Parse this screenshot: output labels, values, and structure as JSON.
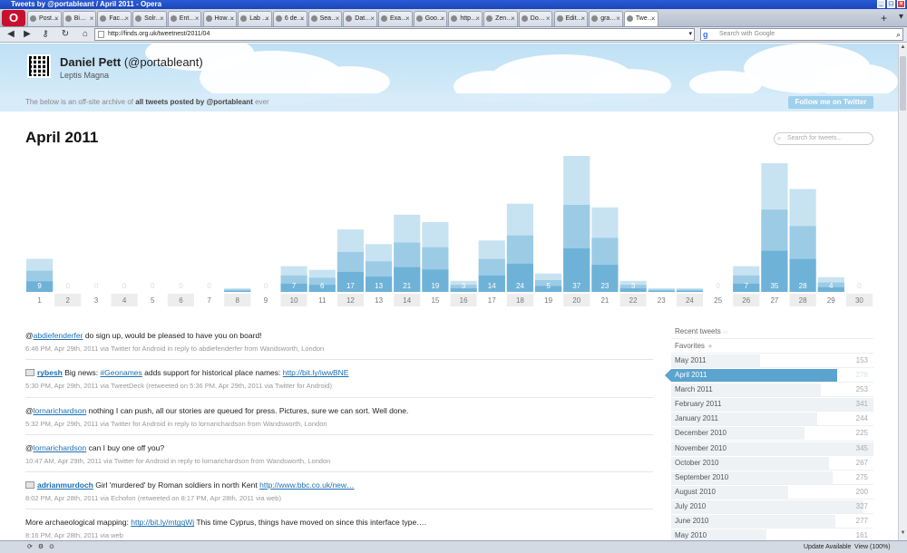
{
  "window": {
    "title": "Tweets by @portableant / April 2011 - Opera"
  },
  "tabs": [
    {
      "label": "Post…"
    },
    {
      "label": "Bi…"
    },
    {
      "label": "Fac…"
    },
    {
      "label": "Solr…"
    },
    {
      "label": "Ent…"
    },
    {
      "label": "How…"
    },
    {
      "label": "Lab …"
    },
    {
      "label": "6 de…"
    },
    {
      "label": "Sea…"
    },
    {
      "label": "Dat…"
    },
    {
      "label": "Exa…"
    },
    {
      "label": "Goo…"
    },
    {
      "label": "http…"
    },
    {
      "label": "Zen…"
    },
    {
      "label": "Do…"
    },
    {
      "label": "Edit…"
    },
    {
      "label": "gra…"
    },
    {
      "label": "Twe…"
    }
  ],
  "address": {
    "url": "http://finds.org.uk/tweetnest/2011/04",
    "search_placeholder": "Search with Google"
  },
  "profile": {
    "name": "Daniel Pett",
    "handle": "(@portableant)",
    "location": "Leptis Magna",
    "archive_pre": "The below is an off-site archive of ",
    "archive_bold": "all tweets posted by @portableant",
    "archive_post": " ever",
    "follow_label": "Follow me on Twitter"
  },
  "page": {
    "month_title": "April 2011",
    "search_placeholder": "Search for tweets..."
  },
  "chart_data": {
    "type": "bar",
    "categories": [
      "1",
      "2",
      "3",
      "4",
      "5",
      "6",
      "7",
      "8",
      "9",
      "10",
      "11",
      "12",
      "13",
      "14",
      "15",
      "16",
      "17",
      "18",
      "19",
      "20",
      "21",
      "22",
      "23",
      "24",
      "25",
      "26",
      "27",
      "28",
      "29",
      "30"
    ],
    "values": [
      9,
      0,
      0,
      0,
      0,
      0,
      0,
      1,
      0,
      7,
      6,
      17,
      13,
      21,
      19,
      3,
      14,
      24,
      5,
      37,
      23,
      3,
      1,
      1,
      0,
      7,
      35,
      28,
      4,
      0
    ],
    "bar_labels": [
      "9",
      "0",
      "0",
      "0",
      "0",
      "0",
      "0",
      "",
      "0",
      "7",
      "6",
      "17",
      "13",
      "21",
      "19",
      "3",
      "14",
      "24",
      "5",
      "37",
      "23",
      "3",
      "",
      "",
      "0",
      "7",
      "35",
      "28",
      "4",
      "0"
    ],
    "colors": {
      "light": "#c7e3f2",
      "mid": "#9ccbe5",
      "dark": "#6fb2d8",
      "label": "#ffffff",
      "zero": "#dddddd"
    },
    "title": "",
    "xlabel": "",
    "ylabel": ""
  },
  "tweets": [
    {
      "rt": false,
      "user": "",
      "pre": "@",
      "link": "abdiefenderfer",
      "text": " do sign up, would be pleased to have you on board!",
      "link2": "",
      "text2": "",
      "meta": "6:46 PM, Apr 29th, 2011 via Twitter for Android in reply to abdiefenderfer from Wandsworth, London"
    },
    {
      "rt": true,
      "user": "rybesh",
      "pre": " Big news: ",
      "link": "#Geonames",
      "text": " adds support for historical place names: ",
      "link2": "http://bit.ly/iwwBNE",
      "text2": "",
      "meta": "5:30 PM, Apr 29th, 2011 via TweetDeck (retweeted on 5:36 PM, Apr 29th, 2011 via Twitter for Android)"
    },
    {
      "rt": false,
      "user": "",
      "pre": "@",
      "link": "lornarichardson",
      "text": " nothing I can push, all our stories are queued for press. Pictures, sure we can sort. Well done.",
      "link2": "",
      "text2": "",
      "meta": "5:32 PM, Apr 29th, 2011 via Twitter for Android in reply to lornarichardson from Wandsworth, London"
    },
    {
      "rt": false,
      "user": "",
      "pre": "@",
      "link": "lornarichardson",
      "text": " can I buy one off you?",
      "link2": "",
      "text2": "",
      "meta": "10:47 AM, Apr 29th, 2011 via Twitter for Android in reply to lornarichardson from Wandsworth, London"
    },
    {
      "rt": true,
      "user": "adrianmurdoch",
      "pre": " Girl 'murdered' by Roman soldiers in north Kent ",
      "link": "http://www.bbc.co.uk/new…",
      "text": "",
      "link2": "",
      "text2": "",
      "meta": "8:02 PM, Apr 28th, 2011 via Echofon (retweeted on 8:17 PM, Apr 28th, 2011 via web)"
    },
    {
      "rt": false,
      "user": "",
      "pre": "More archaeological mapping: ",
      "link": "http://bit.ly/mtgqWj",
      "text": " This time Cyprus, things have moved on since this interface type….",
      "link2": "",
      "text2": "",
      "meta": "8:16 PM, Apr 28th, 2011 via web"
    }
  ],
  "sidebar": {
    "recent_label": "Recent tweets",
    "favorites_label": "Favorites",
    "months": [
      {
        "label": "May 2011",
        "count": "153",
        "fraction": 0.44
      },
      {
        "label": "April 2011",
        "count": "278",
        "fraction": 0.82,
        "active": true
      },
      {
        "label": "March 2011",
        "count": "253",
        "fraction": 0.74
      },
      {
        "label": "February 2011",
        "count": "341",
        "fraction": 1.0
      },
      {
        "label": "January 2011",
        "count": "244",
        "fraction": 0.72
      },
      {
        "label": "December 2010",
        "count": "225",
        "fraction": 0.66
      },
      {
        "label": "November 2010",
        "count": "345",
        "fraction": 1.0
      },
      {
        "label": "October 2010",
        "count": "267",
        "fraction": 0.78
      },
      {
        "label": "September 2010",
        "count": "275",
        "fraction": 0.8
      },
      {
        "label": "August 2010",
        "count": "200",
        "fraction": 0.58
      },
      {
        "label": "July 2010",
        "count": "327",
        "fraction": 0.95
      },
      {
        "label": "June 2010",
        "count": "277",
        "fraction": 0.81
      },
      {
        "label": "May 2010",
        "count": "161",
        "fraction": 0.47
      }
    ]
  },
  "status": {
    "update": "Update Available",
    "zoom": "View (100%)"
  }
}
